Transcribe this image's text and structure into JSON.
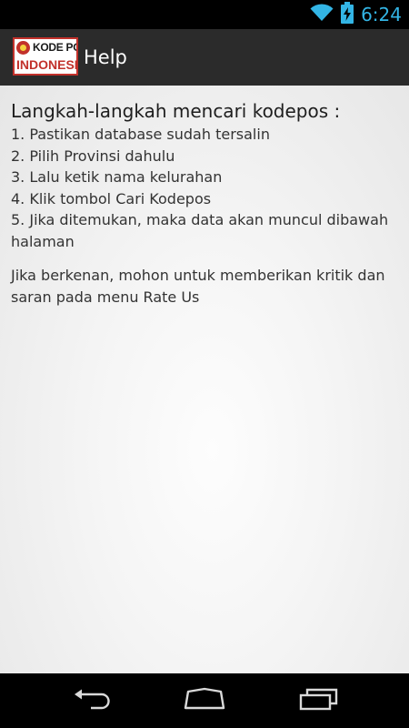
{
  "status_bar": {
    "time": "6:24",
    "wifi_icon": "wifi-icon",
    "battery_icon": "battery-charging-icon",
    "accent_color": "#33b5e5"
  },
  "action_bar": {
    "logo": {
      "top_text": "KODE POS",
      "bottom_text": "INDONESIA"
    },
    "title": "Help"
  },
  "help": {
    "heading": "Langkah-langkah mencari kodepos :",
    "steps": [
      "1. Pastikan database sudah tersalin",
      "2. Pilih Provinsi dahulu",
      "3. Lalu ketik nama kelurahan",
      "4. Klik tombol Cari Kodepos",
      "5. Jika ditemukan, maka data akan muncul dibawah halaman"
    ],
    "note": "Jika berkenan, mohon untuk memberikan kritik dan saran pada menu Rate Us"
  },
  "nav_bar": {
    "back_icon": "back-icon",
    "home_icon": "home-icon",
    "recents_icon": "recents-icon"
  }
}
